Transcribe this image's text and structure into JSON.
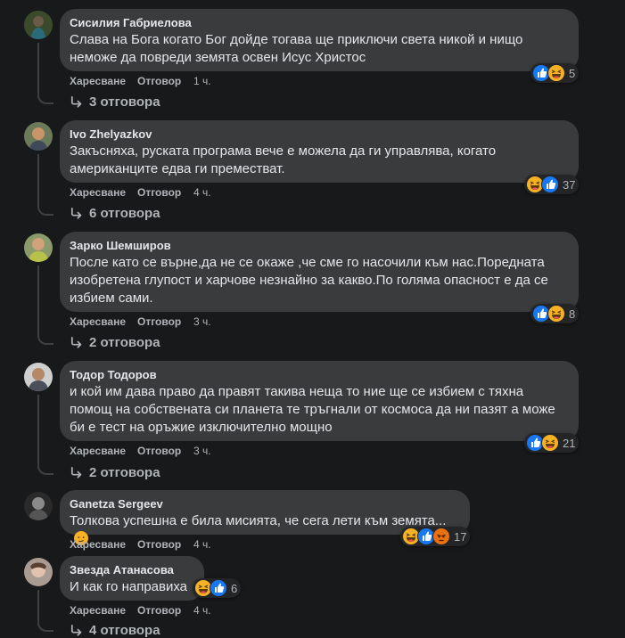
{
  "labels": {
    "like": "Харесване",
    "reply": "Отговор"
  },
  "colors": {
    "background": "#18191a",
    "bubble": "#3a3b3c",
    "like": "#1877f2",
    "haha": "#f7b125",
    "angry": "#e9710f"
  },
  "comments": [
    {
      "author": "Сисилия Габриелова",
      "text": "Слава на Бога когато Бог дойде тогава ще приключи света никой и нищо неможе да повреди земята освен Исус Христос",
      "time": "1 ч.",
      "reaction_count": "5",
      "reactions": [
        "like-icon",
        "haha-icon"
      ],
      "replies": "3 отговора"
    },
    {
      "author": "Ivo Zhelyazkov",
      "text": "Закъсняха, руската програма вече е можела да ги управлява, когато американците едва ги преместват.",
      "time": "4 ч.",
      "reaction_count": "37",
      "reactions": [
        "haha-icon",
        "like-icon"
      ],
      "replies": "6 отговора"
    },
    {
      "author": "Зарко Шемширов",
      "text": "После като се върне,да не се окаже ,че сме го насочили към нас.Поредната изобретена глупост и харчове незнайно за какво.По голяма опасност е да се избием сами.",
      "time": "3 ч.",
      "reaction_count": "8",
      "reactions": [
        "like-icon",
        "haha-icon"
      ],
      "replies": "2 отговора"
    },
    {
      "author": "Тодор Тодоров",
      "text": "и кой им дава право да правят такива неща то ние ще се избием с тяхна помощ на собствената си планета те тръгнали от космоса да ни пазят а може би е тест на оръжие изключително мощно",
      "time": "3 ч.",
      "reaction_count": "21",
      "reactions": [
        "like-icon",
        "haha-icon"
      ],
      "replies": "2 отговора"
    },
    {
      "author": "Ganetza Sergeev",
      "text": "Толкова успешна е била мисията, че сега лети към земята... ",
      "time": "4 ч.",
      "reaction_count": "17",
      "reactions": [
        "haha-icon",
        "like-icon",
        "angry-icon"
      ],
      "replies": ""
    },
    {
      "author": "Звезда Атанасова",
      "text": "И как го направиха",
      "time": "4 ч.",
      "reaction_count": "6",
      "reactions": [
        "haha-icon",
        "like-icon"
      ],
      "replies": "4 отговора"
    }
  ]
}
